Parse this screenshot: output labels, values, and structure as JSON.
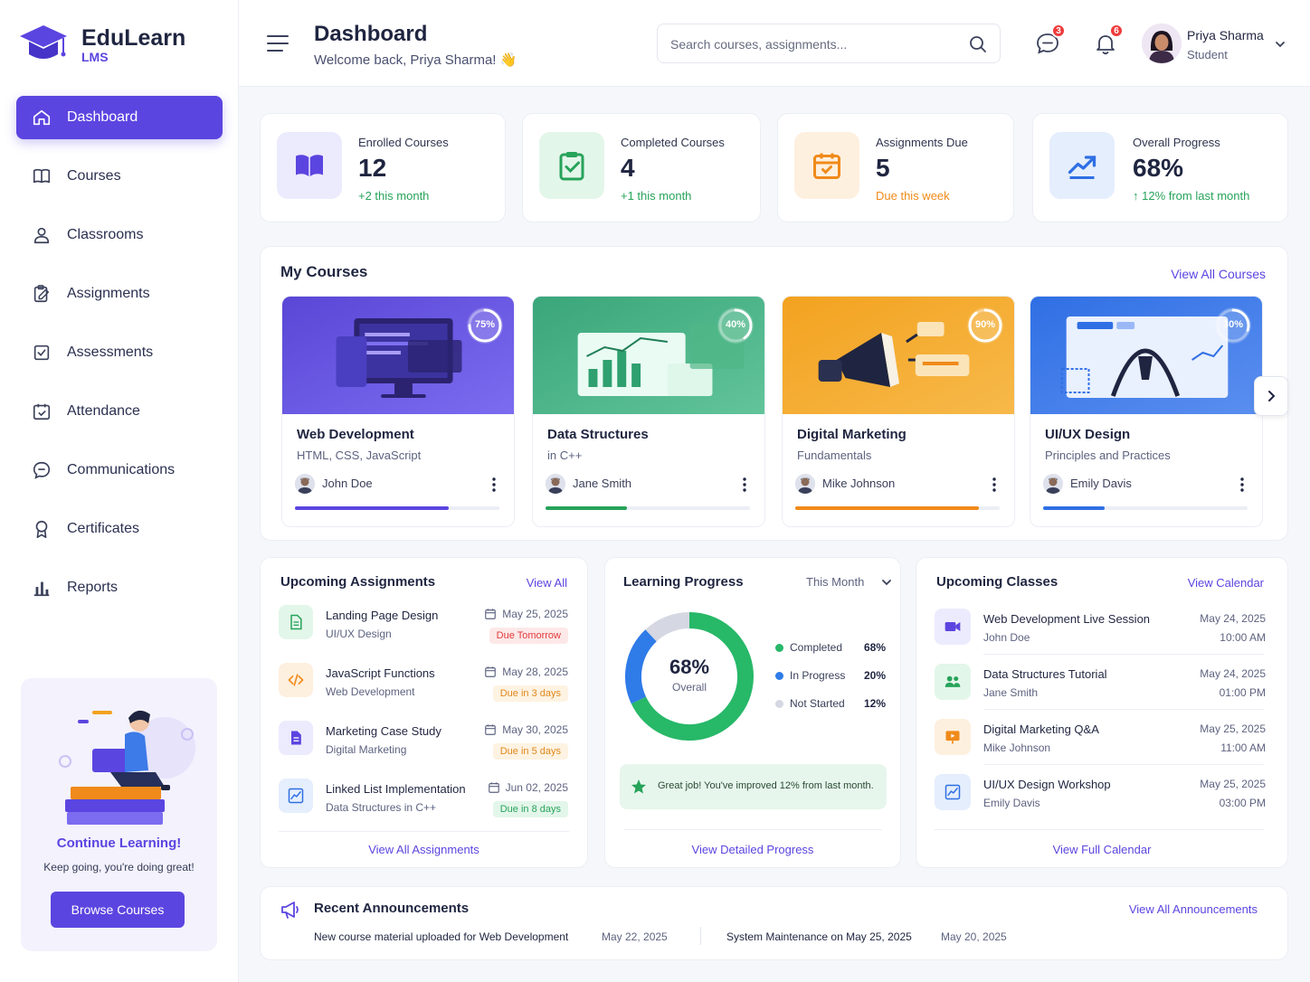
{
  "app": {
    "name": "EduLearn",
    "sub": "LMS"
  },
  "nav": [
    {
      "label": "Dashboard",
      "icon": "home-icon",
      "active": true
    },
    {
      "label": "Courses",
      "icon": "book-icon"
    },
    {
      "label": "Classrooms",
      "icon": "user-icon"
    },
    {
      "label": "Assignments",
      "icon": "clipboard-edit-icon"
    },
    {
      "label": "Assessments",
      "icon": "checkbox-icon"
    },
    {
      "label": "Attendance",
      "icon": "calendar-check-icon"
    },
    {
      "label": "Communications",
      "icon": "chat-icon"
    },
    {
      "label": "Certificates",
      "icon": "award-icon"
    },
    {
      "label": "Reports",
      "icon": "bar-chart-icon"
    }
  ],
  "promo": {
    "title": "Continue Learning!",
    "text": "Keep going, you're doing great!",
    "button": "Browse Courses"
  },
  "header": {
    "title": "Dashboard",
    "welcome": "Welcome back, Priya Sharma! 👋",
    "search_placeholder": "Search courses, assignments...",
    "messages_count": "3",
    "notifications_count": "6",
    "user_name": "Priya Sharma",
    "user_role": "Student"
  },
  "stats": [
    {
      "label": "Enrolled Courses",
      "value": "12",
      "note": "+2 this month",
      "note_color": "#27a35a",
      "icon": "open-book-icon",
      "bg": "#ecebfd",
      "fg": "#5b45e0"
    },
    {
      "label": "Completed Courses",
      "value": "4",
      "note": "+1 this month",
      "note_color": "#27a35a",
      "icon": "clipboard-check-icon",
      "bg": "#e3f6ea",
      "fg": "#27a35a"
    },
    {
      "label": "Assignments Due",
      "value": "5",
      "note": "Due this week",
      "note_color": "#f08a1a",
      "icon": "calendar-icon",
      "bg": "#fef0df",
      "fg": "#f08a1a"
    },
    {
      "label": "Overall Progress",
      "value": "68%",
      "note": "↑ 12% from last month",
      "note_color": "#27a35a",
      "icon": "trend-up-icon",
      "bg": "#e5eefd",
      "fg": "#2f6fe4"
    }
  ],
  "courses": {
    "title": "My Courses",
    "view_all": "View All Courses",
    "items": [
      {
        "name": "Web Development",
        "sub": "HTML, CSS, JavaScript",
        "instructor": "John Doe",
        "progress": 0.75,
        "progress_label": "75%",
        "color": "#5b45e0",
        "banner_from": "#5a47d6",
        "banner_to": "#7b6cf0"
      },
      {
        "name": "Data Structures",
        "sub": "in C++",
        "instructor": "Jane Smith",
        "progress": 0.4,
        "progress_label": "40%",
        "color": "#27a35a",
        "banner_from": "#3aa67a",
        "banner_to": "#62c49a"
      },
      {
        "name": "Digital Marketing",
        "sub": "Fundamentals",
        "instructor": "Mike Johnson",
        "progress": 0.9,
        "progress_label": "90%",
        "color": "#f08a1a",
        "banner_from": "#f3a21f",
        "banner_to": "#f7b94a"
      },
      {
        "name": "UI/UX Design",
        "sub": "Principles and Practices",
        "instructor": "Emily Davis",
        "progress": 0.3,
        "progress_label": "30%",
        "color": "#2f6fe4",
        "banner_from": "#2f6fe4",
        "banner_to": "#5b8ff0"
      }
    ]
  },
  "assignments": {
    "title": "Upcoming Assignments",
    "view_all": "View All",
    "footer": "View All Assignments",
    "items": [
      {
        "title": "Landing Page Design",
        "sub": "UI/UX Design",
        "date": "May 25, 2025",
        "badge": "Due Tomorrow",
        "badge_fg": "#e23b3b",
        "badge_bg": "#fde8e8",
        "icon": "document-icon",
        "icon_bg": "#e3f6ea",
        "icon_fg": "#27a35a"
      },
      {
        "title": "JavaScript Functions",
        "sub": "Web Development",
        "date": "May 28, 2025",
        "badge": "Due in 3 days",
        "badge_fg": "#e0871a",
        "badge_bg": "#fef3e2",
        "icon": "code-icon",
        "icon_bg": "#fef0df",
        "icon_fg": "#f08a1a"
      },
      {
        "title": "Marketing Case Study",
        "sub": "Digital Marketing",
        "date": "May 30, 2025",
        "badge": "Due in 5 days",
        "badge_fg": "#e0871a",
        "badge_bg": "#fef3e2",
        "icon": "file-text-icon",
        "icon_bg": "#ecebfd",
        "icon_fg": "#5b45e0"
      },
      {
        "title": "Linked List Implementation",
        "sub": "Data Structures in C++",
        "date": "Jun 02, 2025",
        "badge": "Due in 8 days",
        "badge_fg": "#27a35a",
        "badge_bg": "#e3f6ea",
        "icon": "chart-line-icon",
        "icon_bg": "#e5eefd",
        "icon_fg": "#2f6fe4"
      }
    ]
  },
  "progress": {
    "title": "Learning Progress",
    "period": "This Month",
    "center_value": "68%",
    "center_label": "Overall",
    "segments": [
      {
        "label": "Completed",
        "value": 68,
        "display": "68%",
        "color": "#27b868"
      },
      {
        "label": "In Progress",
        "value": 20,
        "display": "20%",
        "color": "#2f7be8"
      },
      {
        "label": "Not Started",
        "value": 12,
        "display": "12%",
        "color": "#d5d8e2"
      }
    ],
    "message": "Great job! You've improved 12% from last month.",
    "footer": "View Detailed Progress"
  },
  "classes": {
    "title": "Upcoming Classes",
    "view_all": "View Calendar",
    "footer": "View Full Calendar",
    "items": [
      {
        "title": "Web Development Live Session",
        "instructor": "John Doe",
        "date": "May 24, 2025",
        "time": "10:00 AM",
        "icon": "video-icon",
        "icon_bg": "#ecebfd",
        "icon_fg": "#5b45e0"
      },
      {
        "title": "Data Structures Tutorial",
        "instructor": "Jane Smith",
        "date": "May 24, 2025",
        "time": "01:00 PM",
        "icon": "users-icon",
        "icon_bg": "#e3f6ea",
        "icon_fg": "#27a35a"
      },
      {
        "title": "Digital Marketing Q&A",
        "instructor": "Mike Johnson",
        "date": "May 25, 2025",
        "time": "11:00 AM",
        "icon": "presentation-icon",
        "icon_bg": "#fef0df",
        "icon_fg": "#f08a1a"
      },
      {
        "title": "UI/UX Design Workshop",
        "instructor": "Emily Davis",
        "date": "May 25, 2025",
        "time": "03:00 PM",
        "icon": "chart-line-icon",
        "icon_bg": "#e5eefd",
        "icon_fg": "#2f6fe4"
      }
    ]
  },
  "announcements": {
    "title": "Recent Announcements",
    "view_all": "View All Announcements",
    "items": [
      {
        "text": "New course material uploaded for Web Development",
        "date": "May 22, 2025"
      },
      {
        "text": "System Maintenance on May 25, 2025",
        "date": "May 20, 2025"
      }
    ]
  }
}
